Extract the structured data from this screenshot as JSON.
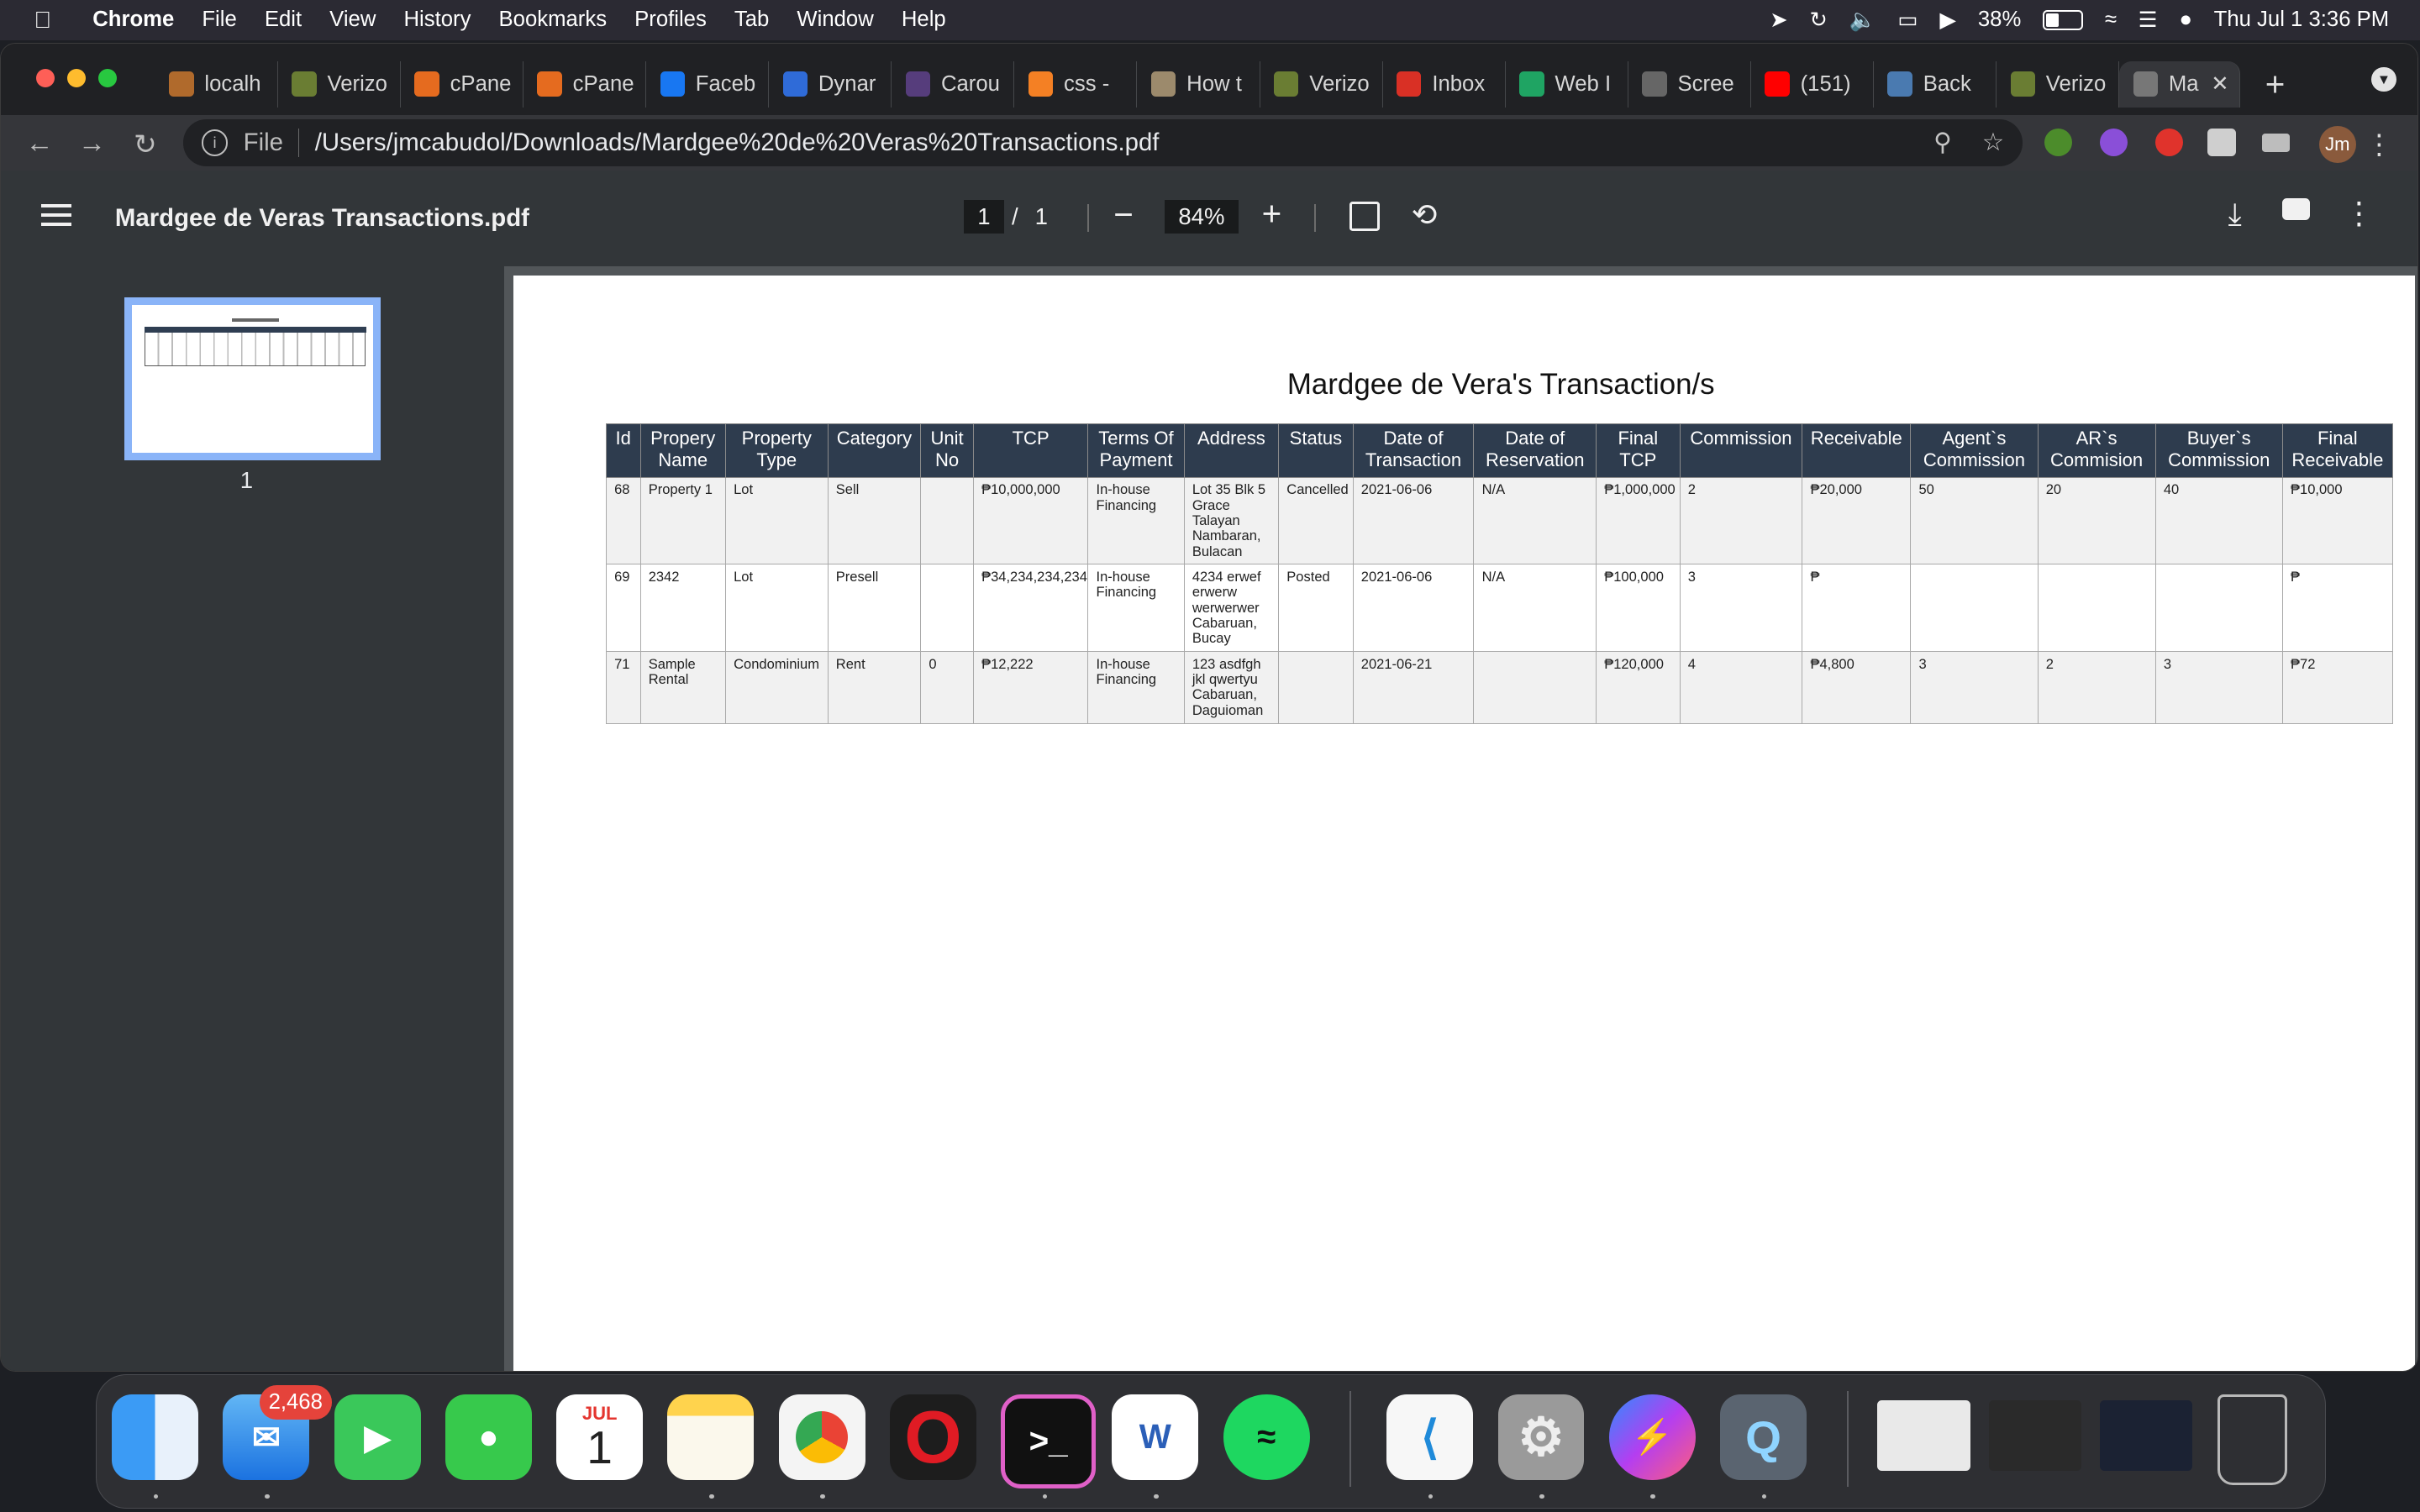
{
  "menubar": {
    "app": "Chrome",
    "items": [
      "File",
      "Edit",
      "View",
      "History",
      "Bookmarks",
      "Profiles",
      "Tab",
      "Window",
      "Help"
    ],
    "battery": "38%",
    "clock": "Thu Jul 1  3:36 PM"
  },
  "tabs": [
    {
      "label": "localh",
      "icon": "localhost-icon",
      "color": "#b06a2c"
    },
    {
      "label": "Verizo",
      "icon": "verizon-icon",
      "color": "#6a7d33"
    },
    {
      "label": "cPane",
      "icon": "cpanel-icon",
      "color": "#e56b1f"
    },
    {
      "label": "cPane",
      "icon": "cpanel-icon",
      "color": "#e56b1f"
    },
    {
      "label": "Faceb",
      "icon": "facebook-icon",
      "color": "#1877f2"
    },
    {
      "label": "Dynar",
      "icon": "wordpress-icon",
      "color": "#2f6bd8"
    },
    {
      "label": "Carou",
      "icon": "bootstrap-icon",
      "color": "#563d7c"
    },
    {
      "label": "css -",
      "icon": "stackoverflow-icon",
      "color": "#f48024"
    },
    {
      "label": "How t",
      "icon": "avatar-icon",
      "color": "#9c8a6c"
    },
    {
      "label": "Verizo",
      "icon": "verizon-icon",
      "color": "#6a7d33"
    },
    {
      "label": "Inbox",
      "icon": "gmail-icon",
      "color": "#d93025"
    },
    {
      "label": "Web I",
      "icon": "drive-icon",
      "color": "#1fa463"
    },
    {
      "label": "Scree",
      "icon": "globe-icon",
      "color": "#666666"
    },
    {
      "label": "(151)",
      "icon": "youtube-icon",
      "color": "#ff0000"
    },
    {
      "label": "Back",
      "icon": "document-icon",
      "color": "#4a7ab0"
    },
    {
      "label": "Verizo",
      "icon": "verizon-icon",
      "color": "#6a7d33"
    },
    {
      "label": "Ma",
      "icon": "globe-icon",
      "color": "#777777"
    }
  ],
  "omnibox": {
    "scheme": "File",
    "url": "/Users/jmcabudol/Downloads/Mardgee%20de%20Veras%20Transactions.pdf"
  },
  "profile": "Jm",
  "pdf": {
    "title": "Mardgee de Veras Transactions.pdf",
    "page": "1",
    "separator": "/",
    "total_pages": "1",
    "zoom": "84%",
    "thumb_label": "1"
  },
  "report": {
    "title": "Mardgee de Vera's Transaction/s",
    "headers": [
      "Id",
      "Propery Name",
      "Property Type",
      "Category",
      "Unit No",
      "TCP",
      "Terms Of Payment",
      "Address",
      "Status",
      "Date of Transaction",
      "Date of Reservation",
      "Final TCP",
      "Commission",
      "Receivable",
      "Agent`s Commission",
      "AR`s Commision",
      "Buyer`s Commission",
      "Final Receivable"
    ],
    "rows": [
      [
        "68",
        "Property 1",
        "Lot",
        "Sell",
        "",
        "₱10,000,000",
        "In-house Financing",
        "Lot 35 Blk 5 Grace Talayan Nambaran, Bulacan",
        "Cancelled",
        "2021-06-06",
        "N/A",
        "₱1,000,000",
        "2",
        "₱20,000",
        "50",
        "20",
        "40",
        "₱10,000"
      ],
      [
        "69",
        "2342",
        "Lot",
        "Presell",
        "",
        "₱34,234,234,234",
        "In-house Financing",
        "4234 erwef erwerw werwerwer Cabaruan, Bucay",
        "Posted",
        "2021-06-06",
        "N/A",
        "₱100,000",
        "3",
        "₱",
        "",
        "",
        "",
        "₱"
      ],
      [
        "71",
        "Sample Rental",
        "Condominium",
        "Rent",
        "0",
        "₱12,222",
        "In-house Financing",
        "123 asdfgh jkl qwertyu Cabaruan, Daguioman",
        "",
        "2021-06-21",
        "",
        "₱120,000",
        "4",
        "₱4,800",
        "3",
        "2",
        "3",
        "₱72"
      ]
    ]
  },
  "dock": {
    "mail_badge": "2,468",
    "calendar_month": "JUL",
    "calendar_day": "1"
  }
}
